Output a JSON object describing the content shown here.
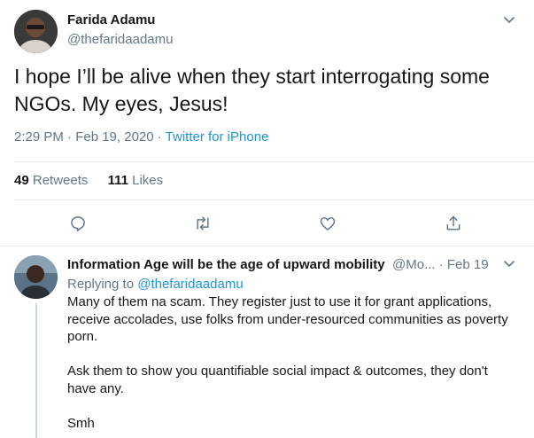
{
  "main_tweet": {
    "author_name": "Farida Adamu",
    "author_handle": "@thefaridaadamu",
    "text": "I hope I’ll be alive when they start interrogating some NGOs. My eyes, Jesus!",
    "time": "2:29 PM · Feb 19, 2020 · ",
    "source": "Twitter for iPhone",
    "retweets_count": "49",
    "retweets_label": "Retweets",
    "likes_count": "111",
    "likes_label": "Likes",
    "icons": [
      "reply-icon",
      "retweet-icon",
      "like-icon",
      "share-icon"
    ]
  },
  "reply_tweet": {
    "author_name": "Information Age will be the age of upward mobility",
    "author_handle_date": "@Mo... · Feb 19",
    "replying_to_label": "Replying to ",
    "replying_to_handle": "@thefaridaadamu",
    "paragraphs": [
      "Many of them na scam. They register just to use it for grant applications, receive accolades, use folks from under-resourced communities as poverty porn.",
      "Ask them to show you quantifiable social impact & outcomes, they don't have any.",
      "Smh"
    ]
  },
  "colors": {
    "text_primary": "#14171a",
    "text_secondary": "#657786",
    "link": "#1b95e0",
    "divider": "#e6ecf0"
  }
}
